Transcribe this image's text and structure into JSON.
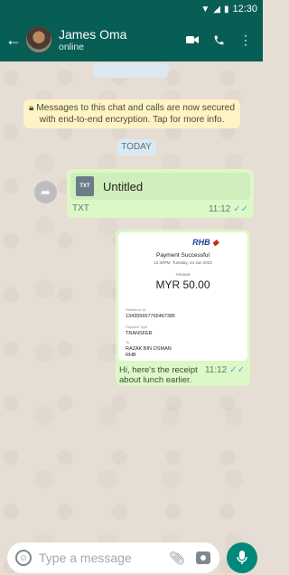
{
  "status": {
    "time": "12:30"
  },
  "header": {
    "contact_name": "James Oma",
    "status": "online"
  },
  "notice": "Messages to this chat and calls are now secured with end-to-end encryption. Tap for more info.",
  "date_chip": "TODAY",
  "messages": [
    {
      "kind": "document",
      "file_name": "Untitled",
      "file_type": "TXT",
      "time": "11:12"
    },
    {
      "kind": "image",
      "receipt": {
        "bank": "RHB",
        "title": "Payment Successful",
        "datetime": "12:30PM, Tuesday, 24 Jan 2023",
        "amount_label": "Amount",
        "amount": "MYR 50.00",
        "ref_label": "Reference ID",
        "ref": "134355657765467385",
        "type_label": "Payment Type",
        "type": "TRANSFER",
        "to_label": "To",
        "to_name": "RAZAK BIN OSMAN",
        "to_bank": "RHB"
      },
      "caption": "Hi, here's the receipt about lunch earlier.",
      "time": "11:12"
    }
  ],
  "composer": {
    "placeholder": "Type a message"
  },
  "colors": {
    "header": "#075e54",
    "outgoing_bubble": "#dcf8c6",
    "accent": "#00897b",
    "ticks": "#34b7f1"
  }
}
